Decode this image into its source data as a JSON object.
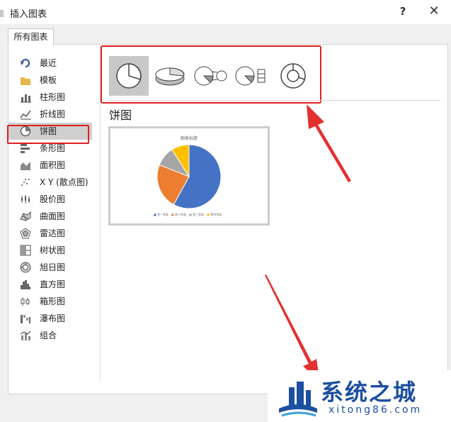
{
  "window": {
    "title": "插入图表",
    "help_label": "?",
    "close_label": "✕"
  },
  "tabs": [
    {
      "label": "所有图表"
    }
  ],
  "sidebar": {
    "selected_index": 3,
    "items": [
      {
        "label": "最近",
        "icon": "undo-arrow-icon"
      },
      {
        "label": "模板",
        "icon": "folder-icon"
      },
      {
        "label": "柱形图",
        "icon": "column-chart-icon"
      },
      {
        "label": "折线图",
        "icon": "line-chart-icon"
      },
      {
        "label": "饼图",
        "icon": "pie-chart-icon"
      },
      {
        "label": "条形图",
        "icon": "bar-chart-icon"
      },
      {
        "label": "面积图",
        "icon": "area-chart-icon"
      },
      {
        "label": "X Y (散点图)",
        "icon": "scatter-chart-icon"
      },
      {
        "label": "股价图",
        "icon": "stock-chart-icon"
      },
      {
        "label": "曲面图",
        "icon": "surface-chart-icon"
      },
      {
        "label": "雷达图",
        "icon": "radar-chart-icon"
      },
      {
        "label": "树状图",
        "icon": "treemap-chart-icon"
      },
      {
        "label": "旭日图",
        "icon": "sunburst-chart-icon"
      },
      {
        "label": "直方图",
        "icon": "histogram-chart-icon"
      },
      {
        "label": "箱形图",
        "icon": "box-whisker-chart-icon"
      },
      {
        "label": "瀑布图",
        "icon": "waterfall-chart-icon"
      },
      {
        "label": "组合",
        "icon": "combo-chart-icon"
      }
    ]
  },
  "subtypes": {
    "selected_index": 0,
    "items": [
      {
        "icon": "pie-icon"
      },
      {
        "icon": "3d-pie-icon"
      },
      {
        "icon": "pie-of-pie-icon"
      },
      {
        "icon": "bar-of-pie-icon"
      },
      {
        "icon": "doughnut-icon"
      }
    ]
  },
  "section_title": "饼图",
  "preview": {
    "title": "图表标题",
    "legend": [
      "第一季度",
      "第二季度",
      "第三季度",
      "第四季度"
    ]
  },
  "chart_data": {
    "type": "pie",
    "title": "图表标题",
    "categories": [
      "第一季度",
      "第二季度",
      "第三季度",
      "第四季度"
    ],
    "values": [
      58,
      23,
      10,
      9
    ],
    "colors": [
      "#4472c4",
      "#ed7d31",
      "#a5a5a5",
      "#ffc000"
    ]
  },
  "colors": {
    "annotation": "#e02020",
    "selected_bg": "#cfcfcf",
    "watermark": "#1c4fa0"
  },
  "watermark": {
    "text": "系统之城",
    "url": "xitong86.com"
  }
}
